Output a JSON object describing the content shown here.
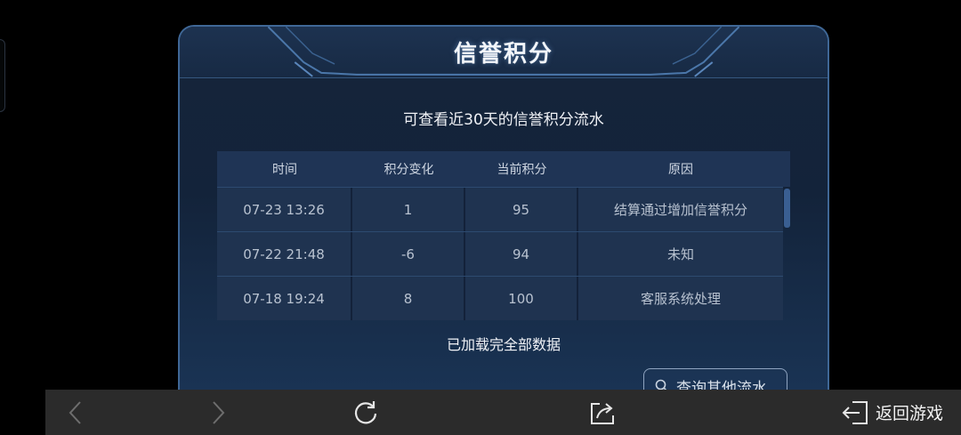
{
  "panel": {
    "title": "信誉积分",
    "subtitle": "可查看近30天的信誉积分流水"
  },
  "table": {
    "headers": [
      "时间",
      "积分变化",
      "当前积分",
      "原因"
    ],
    "rows": [
      [
        "07-23 13:26",
        "1",
        "95",
        "结算通过增加信誉积分"
      ],
      [
        "07-22 21:48",
        "-6",
        "94",
        "未知"
      ],
      [
        "07-18 19:24",
        "8",
        "100",
        "客服系统处理"
      ]
    ]
  },
  "status": {
    "loaded_text": "已加载完全部数据"
  },
  "actions": {
    "query_other_label": "查询其他流水"
  },
  "bottom_nav": {
    "return_label": "返回游戏",
    "icons": [
      "back-arrow-icon",
      "forward-arrow-icon",
      "reload-icon",
      "share-icon",
      "exit-icon"
    ]
  },
  "colors": {
    "panel_border": "#3f6796",
    "panel_bg": "#16243a",
    "table_header_bg": "#1f3455",
    "table_row_bg": "#1f3350",
    "scrollbar": "#3a5f92",
    "bottom_bar": "#2b2b2b"
  }
}
